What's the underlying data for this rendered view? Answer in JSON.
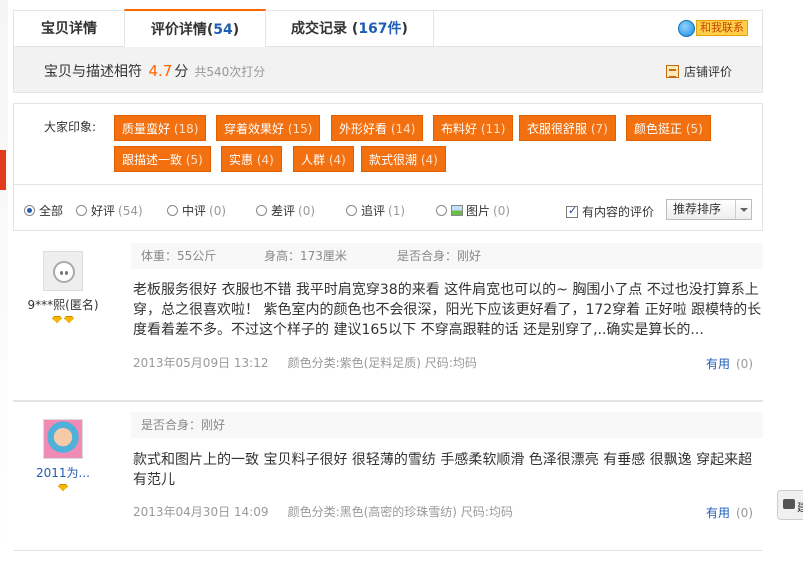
{
  "tabs": [
    {
      "label": "宝贝详情",
      "count": ""
    },
    {
      "label": "评价详情(",
      "count": "54",
      "suffix": ")"
    },
    {
      "label": "成交记录 (",
      "count": "167件",
      "suffix": ")"
    }
  ],
  "contact_label": "和我联系",
  "rating": {
    "prefix": "宝贝与描述相符",
    "score": "4.7",
    "unit": "分",
    "count": "共540次打分",
    "shop_link": "店铺评价"
  },
  "impressions": {
    "title": "大家印象:",
    "tags": [
      {
        "label": "质量蛮好",
        "count": "(18)"
      },
      {
        "label": "穿着效果好",
        "count": "(15)"
      },
      {
        "label": "外形好看",
        "count": "(14)"
      },
      {
        "label": "布料好",
        "count": "(11)"
      },
      {
        "label": "衣服很舒服",
        "count": "(7)"
      },
      {
        "label": "颜色挺正",
        "count": "(5)"
      },
      {
        "label": "跟描述一致",
        "count": "(5)"
      },
      {
        "label": "实惠",
        "count": "(4)"
      },
      {
        "label": "人群",
        "count": "(4)"
      },
      {
        "label": "款式很潮",
        "count": "(4)"
      }
    ]
  },
  "filters": {
    "options": [
      {
        "label": "全部",
        "count": "",
        "selected": true
      },
      {
        "label": "好评",
        "count": "(54)",
        "selected": false
      },
      {
        "label": "中评",
        "count": "(0)",
        "selected": false
      },
      {
        "label": "差评",
        "count": "(0)",
        "selected": false
      },
      {
        "label": "追评",
        "count": "(1)",
        "selected": false
      },
      {
        "label": "图片",
        "count": "(0)",
        "selected": false
      }
    ],
    "with_content_label": "有内容的评价",
    "sort_label": "推荐排序"
  },
  "reviews": [
    {
      "user": "9***熙(匿名)",
      "props": [
        "体重：55公斤",
        "身高：173厘米",
        "是否合身：刚好"
      ],
      "text": "老板服务很好 衣服也不错 我平时肩宽穿38的来看 这件肩宽也可以的~ 胸围小了点 不过也没打算系上穿，总之很喜欢啦！ 紫色室内的颜色也不会很深，阳光下应该更好看了，172穿着 正好啦 跟模特的长度看着差不多。不过这个样子的 建议165以下 不穿高跟鞋的话 还是别穿了,..确实是算长的...",
      "date": "2013年05月09日 13:12",
      "spec": "颜色分类:紫色(足料足质)  尺码:均码",
      "useful": "有用",
      "useful_count": "(0)"
    },
    {
      "user": "2011为...",
      "props": [
        "是否合身：刚好"
      ],
      "text": "款式和图片上的一致 宝贝料子很好 很轻薄的雪纺 手感柔软顺滑 色泽很漂亮 有垂感 很飘逸 穿起来超有范儿",
      "date": "2013年04月30日 14:09",
      "spec": "颜色分类:黑色(高密的珍珠雪纺)  尺码:均码",
      "useful": "有用",
      "useful_count": "(0)"
    }
  ],
  "side_tab": "建"
}
